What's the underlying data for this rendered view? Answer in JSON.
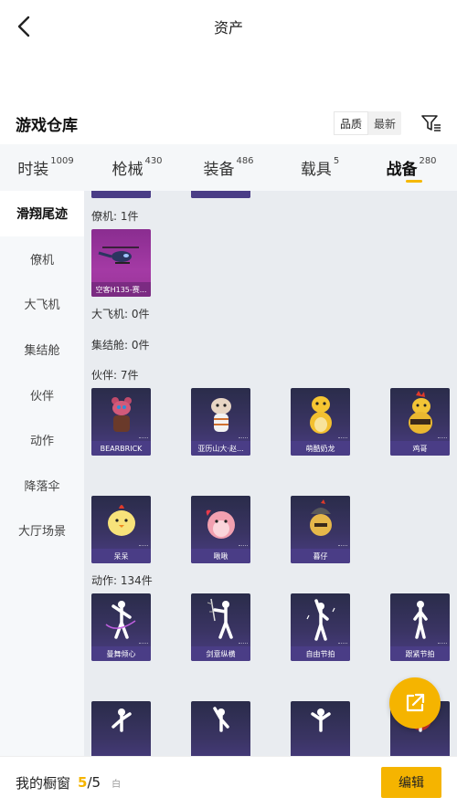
{
  "header": {
    "title": "资产"
  },
  "warehouse": {
    "title": "游戏仓库",
    "sort_options": [
      "品质",
      "最新"
    ]
  },
  "tabs": [
    {
      "label": "时装",
      "count": "1009"
    },
    {
      "label": "枪械",
      "count": "430"
    },
    {
      "label": "装备",
      "count": "486"
    },
    {
      "label": "载具",
      "count": "5"
    },
    {
      "label": "战备",
      "count": "280"
    }
  ],
  "sidebar": [
    "滑翔尾迹",
    "僚机",
    "大飞机",
    "集结舱",
    "伙伴",
    "动作",
    "降落伞",
    "大厅场景"
  ],
  "sections": {
    "wingman": {
      "label": "僚机: 1件",
      "items": [
        "空客H135-赛..."
      ]
    },
    "plane": {
      "label": "大飞机: 0件"
    },
    "pod": {
      "label": "集结舱: 0件"
    },
    "partner": {
      "label": "伙伴: 7件",
      "items": [
        "BEARBRICK",
        "亚历山大·赵...",
        "萌酷奶龙",
        "鸡哥",
        "呆呆",
        "啾啾",
        "暮仔"
      ]
    },
    "action": {
      "label": "动作: 134件",
      "items": [
        "曼舞倾心",
        "剑意纵横",
        "自由节拍",
        "跟紧节拍"
      ]
    }
  },
  "bottom": {
    "label": "我的橱窗",
    "current": "5",
    "total": "/5",
    "lock_icon": "白",
    "edit": "编辑"
  },
  "colors": {
    "accent": "#f5b400",
    "card_bg": "#3a3463"
  }
}
